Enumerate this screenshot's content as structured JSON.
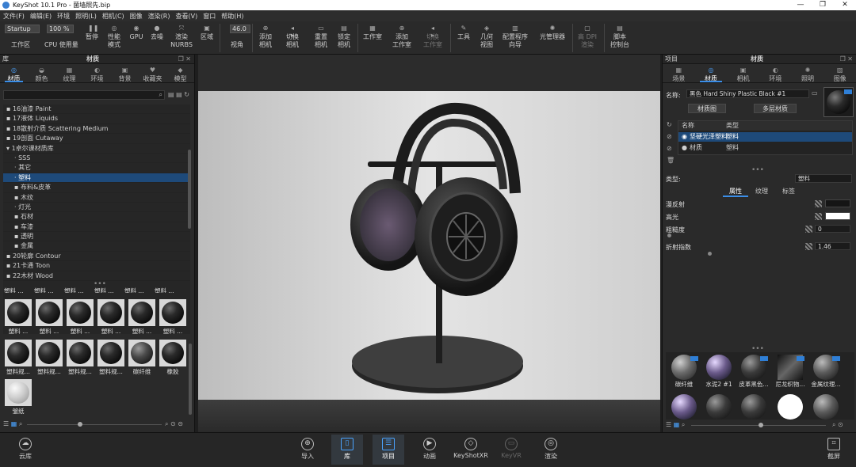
{
  "window": {
    "title": "KeyShot 10.1 Pro - 菌墙照先.bip"
  },
  "menu": [
    "文件(F)",
    "编辑(E)",
    "环境",
    "照明(L)",
    "相机(C)",
    "图像",
    "渲染(R)",
    "查看(V)",
    "窗口",
    "帮助(H)"
  ],
  "toolbar": {
    "preset": "Startup",
    "zoom": "100 %",
    "fov": "46.0",
    "items": {
      "workspace": "工作区",
      "cpu": "CPU 使用量",
      "pause": "暂停",
      "perf": "性能\n模式",
      "gpu": "GPU",
      "denoise": "去噪",
      "nurbs": "渲染\nNURBS",
      "region": "区域",
      "view": "视角",
      "add_camera": "添加\n相机",
      "switch_camera": "切换\n相机",
      "reset_camera": "重置\n相机",
      "lock_camera": "锁定\n相机",
      "studio": "工作室",
      "add_studio": "添加\n工作室",
      "switch_studio": "切换\n工作室",
      "tools": "工具",
      "geom_view": "几何\n视图",
      "config_wizard": "配置程序\n向导",
      "light_manager": "光管理器",
      "hi_dpi": "高 DPI\n渲染",
      "script_console": "脚本\n控制台"
    }
  },
  "left_panel": {
    "header_left": "库",
    "header_title": "材质",
    "tabs": [
      "材质",
      "颜色",
      "纹理",
      "环境",
      "背景",
      "收藏夹",
      "模型"
    ],
    "tree": [
      "16油漆 Paint",
      "17液体 Liquids",
      "18散射介质 Scattering Medium",
      "19剖面 Cutaway",
      "1卓尔课材质库",
      "SSS",
      "其它",
      "塑料",
      "布料&皮革",
      "木纹",
      "灯光",
      "石材",
      "车漆",
      "透明",
      "金属",
      "20轮廓 Contour",
      "21卡通 Toon",
      "22木材 Wood"
    ],
    "swatches": [
      "塑料 ...",
      "塑料 ...",
      "塑料 ...",
      "塑料 ...",
      "塑料 ...",
      "塑料 ...",
      "塑料规...",
      "塑料规...",
      "塑料规...",
      "塑料规...",
      "碳纤维",
      "橡胶",
      "皱纸"
    ]
  },
  "right_panel": {
    "header_left": "项目",
    "header_title": "材质",
    "tabs": [
      "场景",
      "材质",
      "相机",
      "环境",
      "照明",
      "图像"
    ],
    "name_label": "名称:",
    "name_value": "黑色 Hard Shiny Plastic Black #1",
    "btn_graph": "材质图",
    "btn_multi": "多层材质",
    "table_headers": [
      "名称",
      "类型"
    ],
    "table_rows": [
      [
        "坚硬光泽塑料",
        "塑料"
      ],
      [
        "材质",
        "塑料"
      ]
    ],
    "type_label": "类型:",
    "type_value": "塑料",
    "sub_tabs": [
      "属性",
      "纹理",
      "标签"
    ],
    "props": {
      "diffuse": "漫反射",
      "specular": "高光",
      "roughness": "粗糙度",
      "roughness_val": "0",
      "ior": "折射指数",
      "ior_val": "1.46"
    },
    "swatches": [
      "碳纤维",
      "水泥2 #1",
      "皮革黑色...",
      "尼龙织物...",
      "金属纹理..."
    ]
  },
  "bottom": {
    "cloud": "云库",
    "import": "导入",
    "library": "库",
    "project": "项目",
    "animation": "动画",
    "keyshotxr": "KeyShotXR",
    "keyvr": "KeyVR",
    "render": "渲染",
    "screenshot": "截屏"
  },
  "colors": {
    "accent": "#3b8ee8",
    "selection": "#1e4a7a"
  }
}
